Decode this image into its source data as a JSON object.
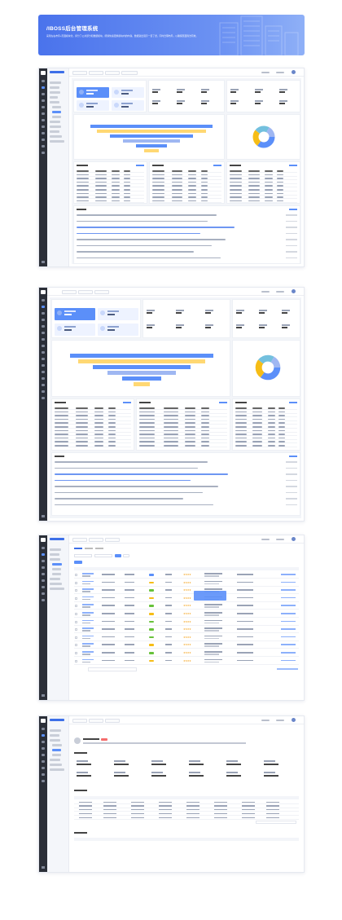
{
  "banner": {
    "title": "/IBOSS后台管理系统",
    "description": "采用左右布局+页面模块化，拆分了公共部分和数据模块，能够快速更换模块内的内容。数据突出展示一目了然，同时合理布局，以确保页面简洁有效。"
  },
  "colors": {
    "accent": "#5b8ff9",
    "sidebar": "#2b2f38",
    "bannerStart": "#4a73ec",
    "bannerEnd": "#8fb0f7",
    "star": "#f5a623",
    "pie": [
      "#5b8ff9",
      "#f6bd16",
      "#73c0de",
      "#9fb7f2",
      "#ffd873"
    ]
  },
  "icons": [
    "logo-icon",
    "menu-icon",
    "avatar-icon",
    "star-icon"
  ]
}
